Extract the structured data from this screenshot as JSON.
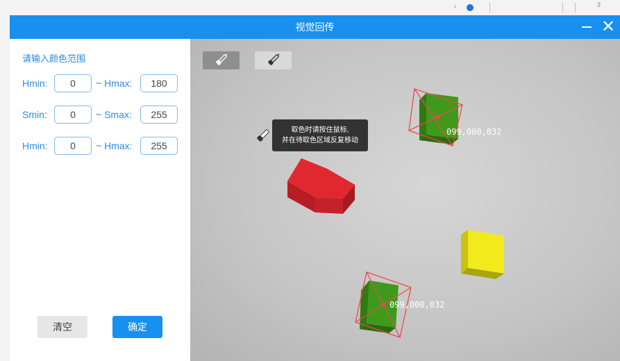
{
  "window": {
    "title": "视觉回传",
    "minimize_icon": "minimize-icon",
    "close_icon": "close-icon",
    "close_glyph": "✕"
  },
  "panel": {
    "heading": "请输入颜色范围",
    "rows": [
      {
        "min_label": "Hmin:",
        "min_value": "0",
        "max_label": "~ Hmax:",
        "max_value": "180"
      },
      {
        "min_label": "Smin:",
        "min_value": "0",
        "max_label": "~ Smax:",
        "max_value": "255"
      },
      {
        "min_label": "Hmin:",
        "min_value": "0",
        "max_label": "~ Hmax:",
        "max_value": "255"
      }
    ],
    "clear_label": "清空",
    "confirm_label": "确定"
  },
  "viewport": {
    "tools": [
      {
        "icon": "eyedropper-icon",
        "state": "active"
      },
      {
        "icon": "eyedropper-icon",
        "state": "inactive"
      }
    ],
    "tooltip_lines": [
      "取色时请按住鼠标,",
      "并在待取色区域反复移动"
    ],
    "detections": [
      {
        "label": "099,000,032",
        "color": "#4aa01f"
      },
      {
        "label": "099,000,032",
        "color": "#4aa01f"
      }
    ],
    "blocks": [
      {
        "name": "red-block",
        "color": "#e02a32"
      },
      {
        "name": "yellow-block",
        "color": "#f3ea1c"
      }
    ]
  },
  "colors": {
    "accent": "#1890ef",
    "label_blue": "#2b8be6",
    "box_border": "#7fb8ee",
    "detection_outline": "#f04848"
  }
}
